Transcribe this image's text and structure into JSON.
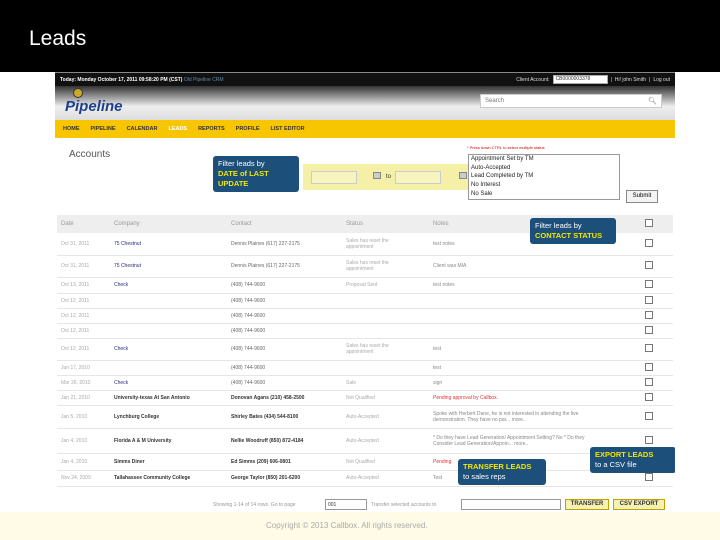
{
  "slide": {
    "title": "Leads",
    "copyright": "Copyright © 2013 Callbox. All rights reserved."
  },
  "topbar": {
    "today": "Today: Monday October 17, 2011 09:58:20 PM (CST)",
    "old_link": "Old Pipeline CRM",
    "client_label": "Client Account:",
    "client_value": "CB0000003378",
    "greeting": "Hi! john Smith",
    "logout": "Log out"
  },
  "brand": {
    "logo": "Pipeline",
    "search_placeholder": "Search",
    "search_icon": "magnifier-icon"
  },
  "nav": [
    "HOME",
    "PIPELINE",
    "CALENDAR",
    "LEADS",
    "REPORTS",
    "PROFILE",
    "LIST EDITOR"
  ],
  "nav_active": "LEADS",
  "page": {
    "title": "Accounts",
    "date_to": "to",
    "hint": "* Press down CTRL to select multiple status",
    "status_options": [
      "Appointment Set by TM",
      "Auto-Accepted",
      "Lead Completed by TM",
      "No Interest",
      "No Sale"
    ],
    "submit": "Submit"
  },
  "callouts": {
    "date": {
      "line1": "Filter leads by",
      "line2": "DATE of LAST",
      "line3": "UPDATE"
    },
    "status": {
      "line1": "Filter leads by",
      "line2": "CONTACT STATUS"
    },
    "transfer": {
      "line1": "TRANSFER LEADS",
      "line2": "to sales reps"
    },
    "export": {
      "line1": "EXPORT LEADS",
      "line2": "to a CSV file"
    }
  },
  "table": {
    "headers": [
      "Date",
      "Company",
      "Contact",
      "Status",
      "Notes"
    ],
    "rows": [
      {
        "date": "Oct 31, 2011",
        "company": "75 Chestnut",
        "contact": "Dennis Plaines (617) 227-2175",
        "status": "Sales has reset the appointment",
        "notes": "test notes"
      },
      {
        "date": "Oct 31, 2011",
        "company": "75 Chestnut",
        "contact": "Dennis Plaines (617) 227-2175",
        "status": "Sales has reset the appointment",
        "notes": "Client was MIA"
      },
      {
        "date": "Oct 13, 2011",
        "company": "Check",
        "contact": "(408) 744-9600",
        "status": "Proposal Sent",
        "notes": "test notes"
      },
      {
        "date": "Oct 12, 2011",
        "company": "",
        "contact": "(408) 744-9600",
        "status": "",
        "notes": ""
      },
      {
        "date": "Oct 12, 2011",
        "company": "",
        "contact": "(408) 744-9600",
        "status": "",
        "notes": ""
      },
      {
        "date": "Oct 12, 2011",
        "company": "",
        "contact": "(408) 744-9600",
        "status": "",
        "notes": ""
      },
      {
        "date": "Oct 12, 2011",
        "company": "Check",
        "contact": "(408) 744-9600",
        "status": "Sales has reset the appointment",
        "notes": "test"
      },
      {
        "date": "Jun 17, 2010",
        "company": "",
        "contact": "(408) 744-9600",
        "status": "",
        "notes": "test"
      },
      {
        "date": "Mar 26, 2010",
        "company": "Check",
        "contact": "(408) 744-9600",
        "status": "Sale",
        "notes": "sign"
      },
      {
        "date": "Jan 21, 2010",
        "company": "University-texas At San Antonio",
        "contact": "Donovan Agans (210) 458-2500",
        "status": "Not Qualified",
        "notes": "Pending approval by Callbox."
      },
      {
        "date": "Jan 5, 2010",
        "company": "Lynchburg College",
        "contact": "Shirley Bates (434) 544-8100",
        "status": "Auto-Accepted",
        "notes": "Spoke with Herbert Dane, he is not interested in attending the live demonstration. They have no par... more.."
      },
      {
        "date": "Jan 4, 2010",
        "company": "Florida A & M University",
        "contact": "Nellie Woodruff (850) 872-4184",
        "status": "Auto-Accepted",
        "notes": "* Do they have Lead Generation/ Appointment Setting? No * Do they Consider Lead Generation/Appoin... more.."
      },
      {
        "date": "Jan 4, 2010",
        "company": "Simms Diner",
        "contact": "Ed Simms (209) 606-0801",
        "status": "Not Qualified",
        "notes": "Pending"
      },
      {
        "date": "Nov 24, 2009",
        "company": "Tallahassee Community College",
        "contact": "George Taylor (850) 201-6200",
        "status": "Auto-Accepted",
        "notes": "Test"
      }
    ]
  },
  "footer": {
    "showing": "Showing 1-14 of 14 rows. Go to page",
    "page": "001",
    "transfer_label": "Transfer selected accounts to",
    "transfer_btn": "TRANSFER",
    "export_btn": "CSV EXPORT"
  }
}
